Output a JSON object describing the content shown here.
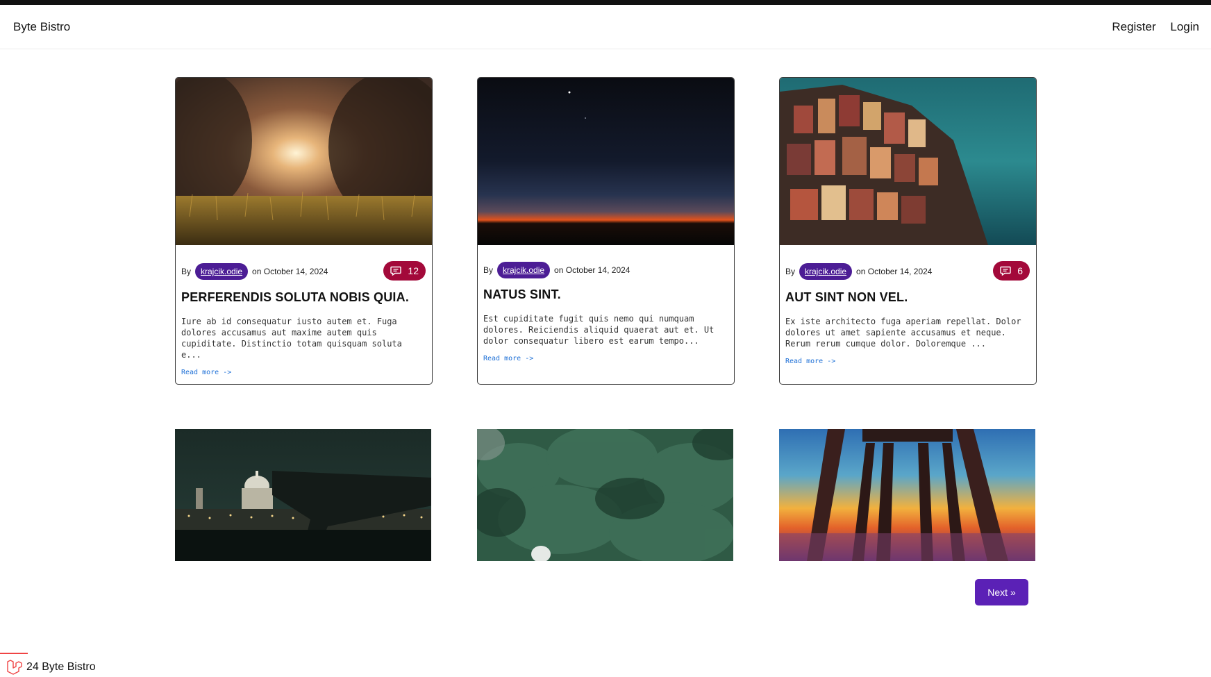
{
  "nav": {
    "brand": "Byte Bistro",
    "links": [
      "Register",
      "Login"
    ]
  },
  "posts": [
    {
      "by": "By",
      "author": "krajcik.odie",
      "date": "on October 14, 2024",
      "comments": "12",
      "title": "PERFERENDIS SOLUTA NOBIS QUIA.",
      "excerpt": "Iure ab id consequatur iusto autem et. Fuga dolores accusamus aut maxime autem quis cupiditate. Distinctio totam quisquam soluta e...",
      "read_more": "Read more ->",
      "image": "sunlit-grass-field"
    },
    {
      "by": "By",
      "author": "krajcik.odie",
      "date": "on October 14, 2024",
      "comments": "",
      "title": "NATUS SINT.",
      "excerpt": "Est cupiditate fugit quis nemo qui numquam dolores. Reiciendis aliquid quaerat aut et. Ut dolor consequatur libero est earum tempo...",
      "read_more": "Read more ->",
      "image": "night-sky-horizon"
    },
    {
      "by": "By",
      "author": "krajcik.odie",
      "date": "on October 14, 2024",
      "comments": "6",
      "title": "AUT SINT NON VEL.",
      "excerpt": "Ex iste architecto fuga aperiam repellat. Dolor dolores ut amet sapiente accusamus et neque. Rerum rerum cumque dolor. Doloremque ...",
      "read_more": "Read more ->",
      "image": "cliffside-village"
    },
    {
      "image": "city-night-dome"
    },
    {
      "image": "evergreen-forest"
    },
    {
      "image": "pier-sunset"
    }
  ],
  "pagination": {
    "next": "Next »"
  },
  "footer": {
    "text": "24 Byte Bistro"
  },
  "colors": {
    "author_badge": "#4c1d95",
    "comment_badge": "#a3093a",
    "next_button": "#5b21b6",
    "link": "#1d6fd6"
  }
}
